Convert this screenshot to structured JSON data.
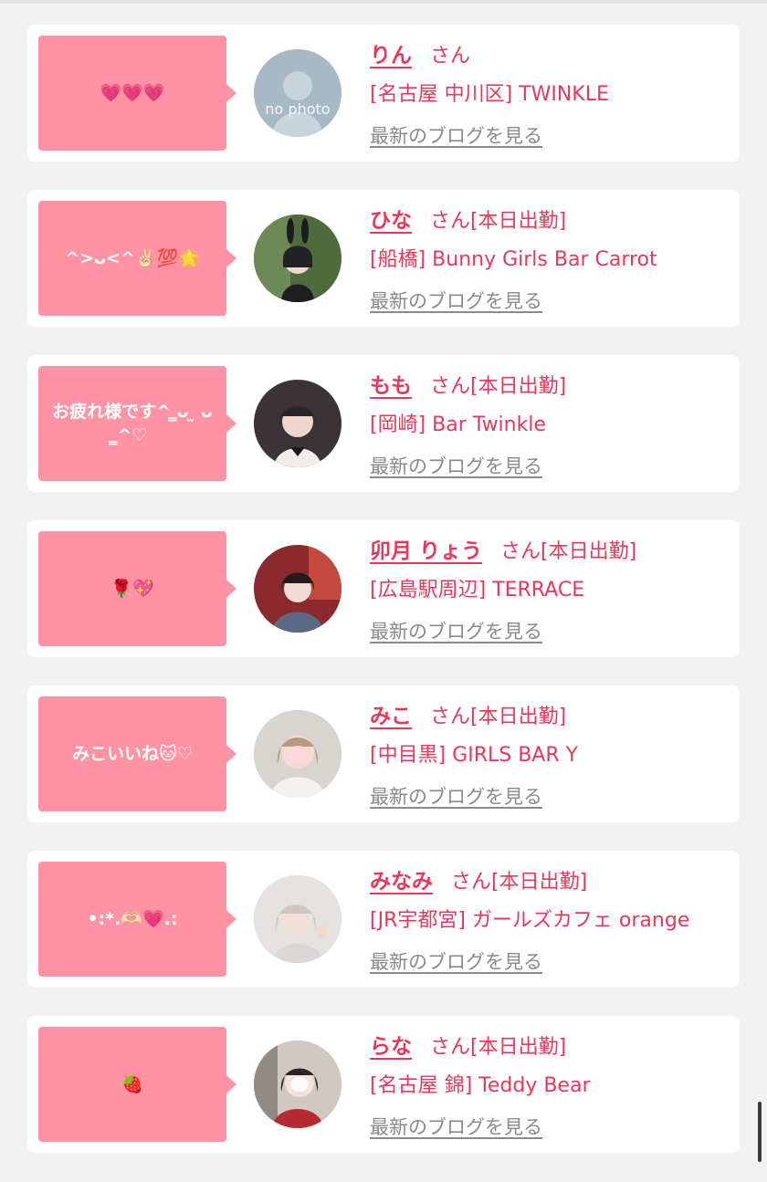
{
  "san_label": "さん",
  "blog_link_label": "最新のブログを見る",
  "avatars": [
    "no photo"
  ],
  "colors": {
    "accent": "#e8385a",
    "bubble": "#ff93a3",
    "link_gray": "#8a8a8a"
  },
  "cards": [
    {
      "message": "💗💗💗",
      "name": "りん",
      "shift": "",
      "place": "[名古屋 中川区] TWINKLE"
    },
    {
      "message": "^>ᴗ<^✌🏻💯🌟",
      "name": "ひな",
      "shift": "[本日出勤]",
      "place": "[船橋] Bunny Girls Bar Carrot"
    },
    {
      "message": "お疲れ様です^ ̳ᴗ ̫ ᴗ ̳^♡",
      "name": "もも",
      "shift": "[本日出勤]",
      "place": "[岡崎] Bar Twinkle"
    },
    {
      "message": "🌹💖",
      "name": "卯月 りょう",
      "shift": "[本日出勤]",
      "place": "[広島駅周辺] TERRACE"
    },
    {
      "message": "みこいいね🐱♡",
      "name": "みこ",
      "shift": "[本日出勤]",
      "place": "[中目黒] GIRLS BAR Y"
    },
    {
      "message": "•:*.🫶🏻💗.:",
      "name": "みなみ",
      "shift": "[本日出勤]",
      "place": "[JR宇都宮] ガールズカフェ orange"
    },
    {
      "message": "🍓",
      "name": "らな",
      "shift": "[本日出勤]",
      "place": "[名古屋 錦] Teddy Bear"
    }
  ]
}
